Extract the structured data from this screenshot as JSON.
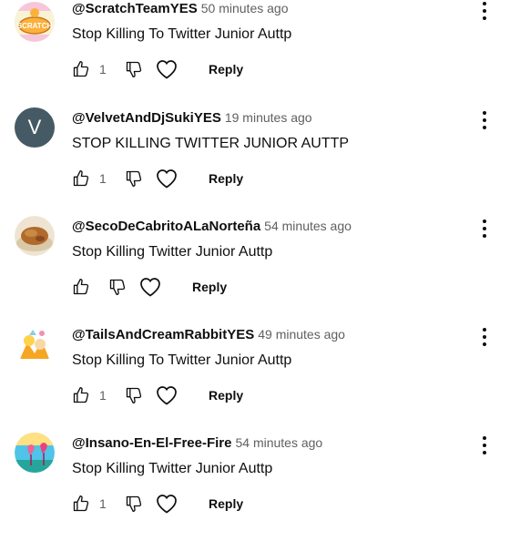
{
  "comments": [
    {
      "author": "@ScratchTeamYES",
      "time": "50 minutes ago",
      "text": "Stop Killing To Twitter Junior Auttp",
      "likes": "1",
      "reply_label": "Reply",
      "avatar": "scratch-logo",
      "avatar_color": "#f7c6d9"
    },
    {
      "author": "@VelvetAndDjSukiYES",
      "time": "19 minutes ago",
      "text": "STOP KILLING TWITTER JUNIOR AUTTP",
      "likes": "1",
      "reply_label": "Reply",
      "avatar": "letter",
      "avatar_letter": "V",
      "avatar_color": "#455a64"
    },
    {
      "author": "@SecoDeCabritoALaNorteña",
      "time": "54 minutes ago",
      "text": "Stop Killing Twitter Junior Auttp",
      "likes": "",
      "reply_label": "Reply",
      "avatar": "food-photo",
      "avatar_color": "#b06a2c"
    },
    {
      "author": "@TailsAndCreamRabbitYES",
      "time": "49 minutes ago",
      "text": "Stop Killing To Twitter Junior Auttp",
      "likes": "1",
      "reply_label": "Reply",
      "avatar": "character-art",
      "avatar_color": "#f5a623"
    },
    {
      "author": "@Insano-En-El-Free-Fire",
      "time": "54 minutes ago",
      "text": "Stop Killing Twitter Junior Auttp",
      "likes": "1",
      "reply_label": "Reply",
      "avatar": "flamingo-art",
      "avatar_color": "#4fc3e8"
    }
  ]
}
